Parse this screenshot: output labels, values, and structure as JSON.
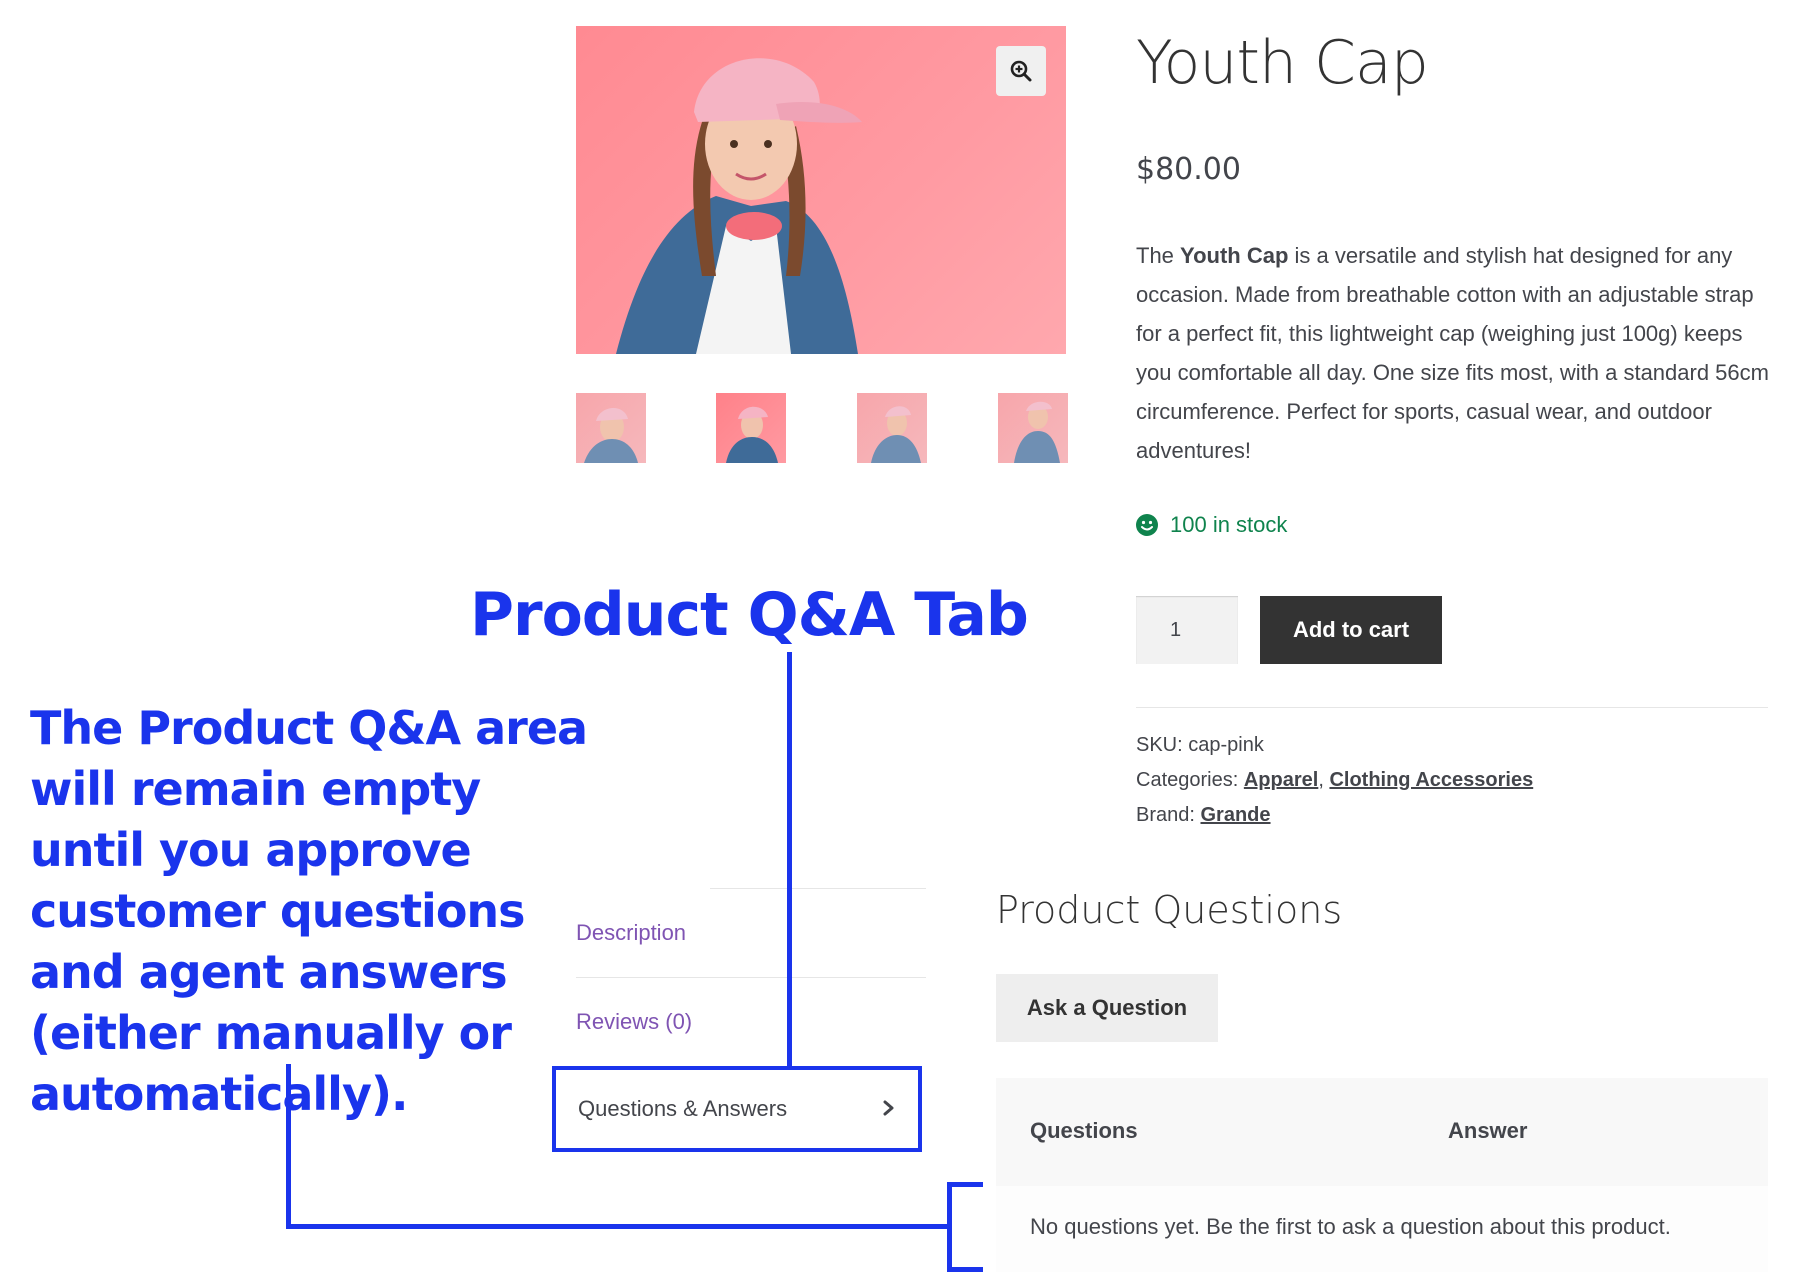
{
  "product": {
    "title": "Youth Cap",
    "price": "$80.00",
    "description_pre": "The ",
    "description_bold": "Youth Cap",
    "description_post": " is a versatile and stylish hat designed for any occasion. Made from breathable cotton with an adjustable strap for a perfect fit, this lightweight cap (weighing just 100g) keeps you comfortable all day. One size fits most, with a standard 56cm circumference. Perfect for sports, casual wear, and outdoor adventures!",
    "stock": "100 in stock",
    "quantity": "1",
    "add_to_cart": "Add to cart",
    "sku_label": "SKU:",
    "sku_value": "cap-pink",
    "categories_label": "Categories:",
    "category_1": "Apparel",
    "category_sep": ",",
    "category_2": "Clothing Accessories",
    "brand_label": "Brand:",
    "brand_value": "Grande"
  },
  "tabs": {
    "description": "Description",
    "reviews": "Reviews (0)",
    "questions": "Questions & Answers"
  },
  "questions_panel": {
    "title": "Product Questions",
    "ask_button": "Ask a Question",
    "col_questions": "Questions",
    "col_answer": "Answer",
    "empty_message": "No questions yet. Be the first to ask a question about this product."
  },
  "annotations": {
    "tab_label": "Product Q&A Tab",
    "note": "The Product Q&A area will remain empty until you approve customer questions and agent answers (either manually or automatically)."
  },
  "colors": {
    "annotation_blue": "#1a34ec",
    "tab_link": "#7f54b3",
    "stock_green": "#0f834d",
    "button_dark": "#333333"
  },
  "icons": [
    "zoom-in-icon",
    "smiley-stock-icon",
    "chevron-right-icon"
  ]
}
